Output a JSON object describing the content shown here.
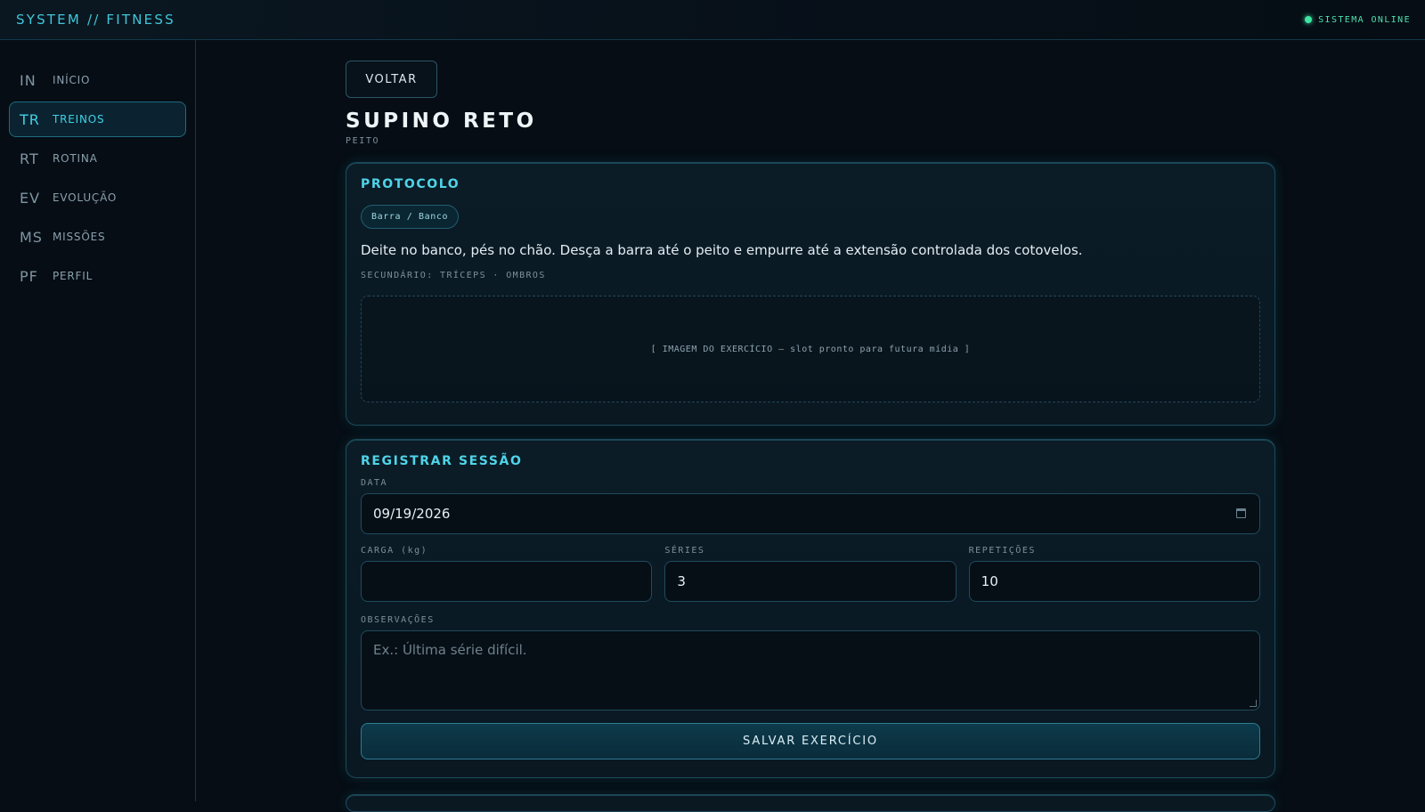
{
  "app": {
    "brand": "SYSTEM // FITNESS",
    "status_text": "SISTEMA ONLINE",
    "status_color": "#3ee6a2",
    "accent_color": "#3fc7d9"
  },
  "sidebar": {
    "items": [
      {
        "code": "IN",
        "label": "INÍCIO",
        "active": false
      },
      {
        "code": "TR",
        "label": "TREINOS",
        "active": true
      },
      {
        "code": "RT",
        "label": "ROTINA",
        "active": false
      },
      {
        "code": "EV",
        "label": "EVOLUÇÃO",
        "active": false
      },
      {
        "code": "MS",
        "label": "MISSÕES",
        "active": false
      },
      {
        "code": "PF",
        "label": "PERFIL",
        "active": false
      }
    ]
  },
  "exercise": {
    "back_label": "VOLTAR",
    "title": "SUPINO RETO",
    "group": "PEITO"
  },
  "protocol": {
    "title": "PROTOCOLO",
    "equipment_tag": "Barra / Banco",
    "description": "Deite no banco, pés no chão. Desça a barra até o peito e empurre até a extensão controlada dos cotovelos.",
    "secondary": "SECUNDÁRIO: TRÍCEPS · OMBROS",
    "media_placeholder": "[ IMAGEM DO EXERCÍCIO — slot pronto para futura mídia ]"
  },
  "session": {
    "title": "REGISTRAR SESSÃO",
    "date_label": "DATA",
    "date_value": "09/19/2026",
    "load_label": "CARGA (kg)",
    "load_value": "",
    "sets_label": "SÉRIES",
    "sets_value": "3",
    "reps_label": "REPETIÇÕES",
    "reps_value": "10",
    "notes_label": "OBSERVAÇÕES",
    "notes_placeholder": "Ex.: Última série difícil.",
    "save_label": "SALVAR EXERCÍCIO"
  }
}
